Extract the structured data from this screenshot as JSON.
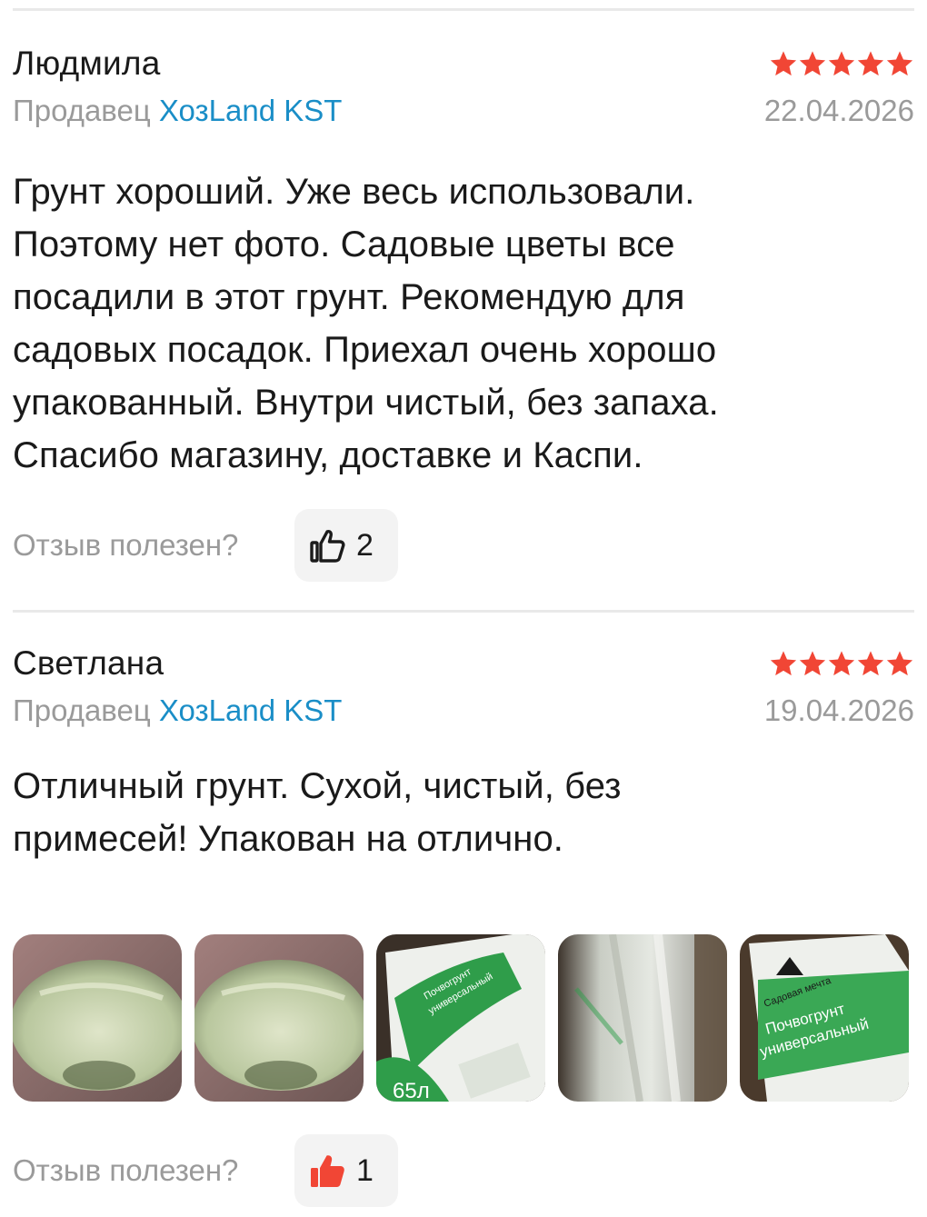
{
  "reviews": [
    {
      "author": "Людмила",
      "rating": 5,
      "seller_prefix": "Продавец",
      "seller_name": "ХозLand KST",
      "date": "22.04.2026",
      "lines": [
        "Грунт хороший. Уже весь использовали.",
        "Поэтому нет фото. Садовые цветы все",
        "посадили в этот грунт. Рекомендую для",
        "садовых посадок. Приехал очень хорошо",
        "упакованный. Внутри чистый, без запаха.",
        "Спасибо магазину, доставке и Каспи."
      ],
      "helpful_label": "Отзыв полезен?",
      "likes": "2",
      "liked": false
    },
    {
      "author": "Светлана",
      "rating": 5,
      "seller_prefix": "Продавец",
      "seller_name": "ХозLand KST",
      "date": "19.04.2026",
      "lines": [
        "Отличный грунт. Сухой, чистый, без",
        "примесей! Упакован на отлично."
      ],
      "photos": [
        {
          "kind": "sack-photo-icon",
          "texts": []
        },
        {
          "kind": "sack-photo-icon",
          "texts": []
        },
        {
          "kind": "soil-bag-photo-icon",
          "texts": [
            "Почвогрунт",
            "универсальный",
            "65л"
          ]
        },
        {
          "kind": "sack-closeup-photo-icon",
          "texts": []
        },
        {
          "kind": "soil-bag-photo-icon",
          "texts": [
            "Садовая мечта",
            "Почвогрунт",
            "универсальный"
          ]
        }
      ],
      "helpful_label": "Отзыв полезен?",
      "likes": "1",
      "liked": true
    }
  ],
  "colors": {
    "star": "#f14635",
    "seller_link": "#1a8ec7",
    "muted": "#9a9a9a",
    "like_active": "#f14635"
  }
}
